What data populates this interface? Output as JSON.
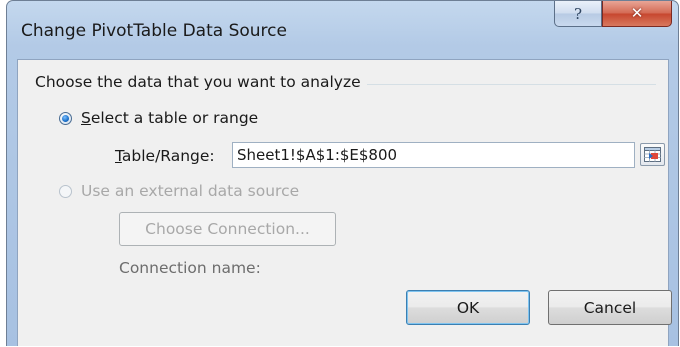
{
  "window": {
    "title": "Change PivotTable Data Source",
    "help_glyph": "?",
    "close_glyph": "✕"
  },
  "group": {
    "header": "Choose the data that you want to analyze"
  },
  "options": {
    "select_range": {
      "label_accel": "S",
      "label_rest": "elect a table or range",
      "checked": true
    },
    "external": {
      "label": "Use an external data source",
      "checked": false,
      "disabled": true
    }
  },
  "range": {
    "label_accel": "T",
    "label_rest": "able/Range:",
    "value": "Sheet1!$A$1:$E$800"
  },
  "connection": {
    "choose_button": "Choose Connection...",
    "name_label": "Connection name:"
  },
  "buttons": {
    "ok": "OK",
    "cancel": "Cancel"
  },
  "colors": {
    "title_gradient_top": "#c4d8ee",
    "close_red": "#c7472f",
    "radio_selected": "#1a6fc9",
    "default_button_border": "#3c7fb1"
  }
}
